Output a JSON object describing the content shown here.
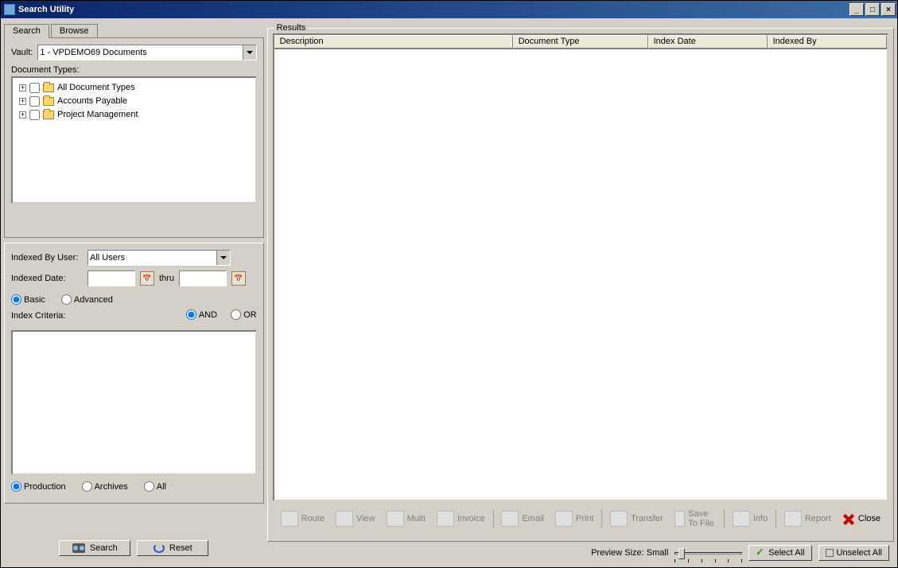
{
  "window": {
    "title": "Search Utility"
  },
  "tabs": {
    "search": "Search",
    "browse": "Browse"
  },
  "vault": {
    "label": "Vault:",
    "value": "1 - VPDEMO69 Documents"
  },
  "doctypes": {
    "label": "Document Types:",
    "items": [
      {
        "label": "All Document Types"
      },
      {
        "label": "Accounts Payable"
      },
      {
        "label": "Project Management"
      }
    ]
  },
  "indexedByUser": {
    "label": "Indexed By User:",
    "value": "All Users"
  },
  "indexedDate": {
    "label": "Indexed Date:",
    "thru": "thru"
  },
  "mode": {
    "basic": "Basic",
    "advanced": "Advanced"
  },
  "criteria": {
    "label": "Index Criteria:",
    "and": "AND",
    "or": "OR"
  },
  "scope": {
    "production": "Production",
    "archives": "Archives",
    "all": "All"
  },
  "buttons": {
    "search": "Search",
    "reset": "Reset"
  },
  "results": {
    "legend": "Results",
    "cols": {
      "description": "Description",
      "doctype": "Document Type",
      "indexdate": "Index Date",
      "indexedby": "Indexed By"
    }
  },
  "toolbar": {
    "route": "Route",
    "view": "View",
    "multi": "Multi",
    "invoice": "Invoice",
    "email": "Email",
    "print": "Print",
    "transfer": "Transfer",
    "save": "Save To File",
    "info": "Info",
    "report": "Report",
    "close": "Close"
  },
  "preview": {
    "label": "Preview Size: Small"
  },
  "select": {
    "all": "Select All",
    "none": "Unselect All"
  }
}
